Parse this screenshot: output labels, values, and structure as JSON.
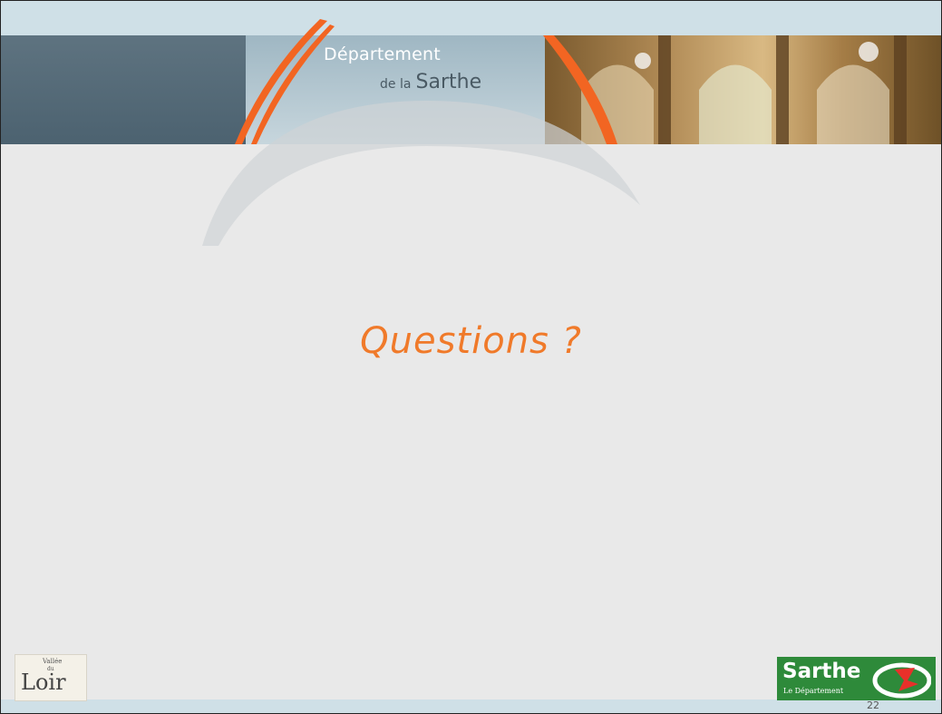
{
  "header": {
    "title_line1": "Département",
    "title_line2_small": "de la",
    "title_line2_big": "Sarthe"
  },
  "main": {
    "question_text": "Questions ?"
  },
  "footer": {
    "logo_left": {
      "top": "Vallée",
      "middle": "du",
      "name": "Loir"
    },
    "logo_right": {
      "name": "Sarthe",
      "subtitle": "Le Département"
    },
    "page_number": "22"
  },
  "colors": {
    "accent": "#f07a2a",
    "slate": "#566b78",
    "background": "#e9e9e9",
    "green": "#2e8a3a"
  }
}
